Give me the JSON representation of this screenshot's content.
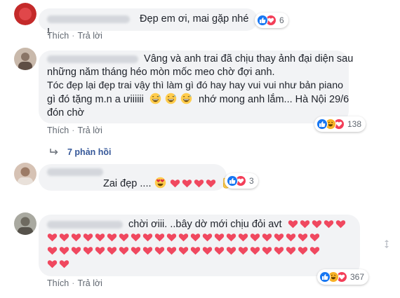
{
  "comments": [
    {
      "text": "Đẹp em ơi, mai gặp nhé !",
      "reaction_count": "6"
    },
    {
      "lines": [
        "Vâng và anh trai đã chịu thay ảnh đại diện sau",
        "những năm tháng héo mòn mốc meo chờ đợi anh.",
        "Tóc đẹp lại đẹp trai vậy thì làm gì đó hay hay vui vui như bản piano",
        "gì đó tặng m.n a ưiiiiii",
        "nhớ mong anh lắm... Hà Nội 29/6",
        "đón chờ"
      ],
      "reaction_count": "138",
      "replies_label": "7 phản hồi"
    },
    {
      "text": "Zai đẹp ....",
      "reaction_count": "3"
    },
    {
      "text": "chời ơiii. ..bây dờ mới chịu đỏi avt",
      "reaction_count": "367"
    }
  ],
  "actions": {
    "like": "Thích",
    "separator": "·",
    "reply": "Trả lời"
  },
  "colors": {
    "like_blue": "#1877f2",
    "love_red": "#f33e58",
    "haha_yellow": "#f7b125",
    "link": "#365899",
    "bubble": "#f2f3f5"
  },
  "icons": [
    "like-icon",
    "love-icon",
    "haha-icon",
    "reply-arrow-icon",
    "heart-icon",
    "grinning-sweat-emoji",
    "heart-eyes-emoji",
    "victory-hand-emoji",
    "scroll-icon"
  ]
}
